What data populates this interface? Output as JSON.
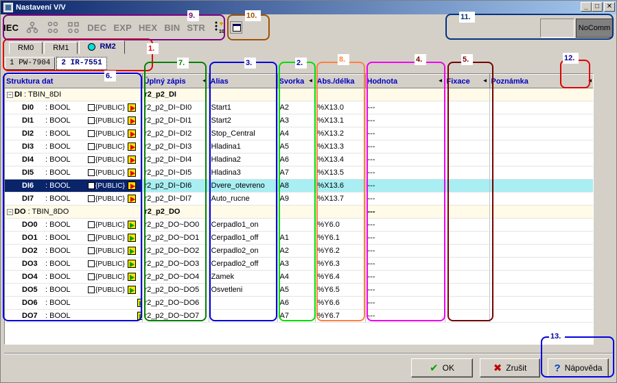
{
  "window": {
    "title": "Nastavení V/V"
  },
  "toolbar": {
    "iec": "IEC",
    "formats": [
      "DEC",
      "EXP",
      "HEX",
      "BIN",
      "STR"
    ]
  },
  "status": {
    "comm": "NoComm"
  },
  "rm_tabs": [
    "RM0",
    "RM1",
    "RM2"
  ],
  "module_tabs": [
    "1 PW-7904",
    "2 IR-7551"
  ],
  "columns": {
    "structure": "Struktura dat",
    "full": "Úplný zápis",
    "alias": "Alias",
    "terminal": "Svorka",
    "abs": "Abs./délka",
    "value": "Hodnota",
    "fix": "Fixace",
    "note": "Poznámka"
  },
  "rows": [
    {
      "kind": "group",
      "pm": "−",
      "name": "DI",
      "type": ": TBIN_8DI",
      "full": "r2_p2_DI"
    },
    {
      "kind": "item",
      "name": "DI0",
      "type": ": BOOL",
      "pub": "{PUBLIC}",
      "dir": "in",
      "full": "r2_p2_DI~DI0",
      "alias": "Start1",
      "terminal": "A2",
      "abs": "%X13.0",
      "value": "---"
    },
    {
      "kind": "item",
      "name": "DI1",
      "type": ": BOOL",
      "pub": "{PUBLIC}",
      "dir": "in",
      "full": "r2_p2_DI~DI1",
      "alias": "Start2",
      "terminal": "A3",
      "abs": "%X13.1",
      "value": "---"
    },
    {
      "kind": "item",
      "name": "DI2",
      "type": ": BOOL",
      "pub": "{PUBLIC}",
      "dir": "in",
      "full": "r2_p2_DI~DI2",
      "alias": "Stop_Central",
      "terminal": "A4",
      "abs": "%X13.2",
      "value": "---"
    },
    {
      "kind": "item",
      "name": "DI3",
      "type": ": BOOL",
      "pub": "{PUBLIC}",
      "dir": "in",
      "full": "r2_p2_DI~DI3",
      "alias": "Hladina1",
      "terminal": "A5",
      "abs": "%X13.3",
      "value": "---"
    },
    {
      "kind": "item",
      "name": "DI4",
      "type": ": BOOL",
      "pub": "{PUBLIC}",
      "dir": "in",
      "full": "r2_p2_DI~DI4",
      "alias": "Hladina2",
      "terminal": "A6",
      "abs": "%X13.4",
      "value": "---"
    },
    {
      "kind": "item",
      "name": "DI5",
      "type": ": BOOL",
      "pub": "{PUBLIC}",
      "dir": "in",
      "full": "r2_p2_DI~DI5",
      "alias": "Hladina3",
      "terminal": "A7",
      "abs": "%X13.5",
      "value": "---"
    },
    {
      "kind": "item",
      "sel": true,
      "name": "DI6",
      "type": ": BOOL",
      "pub": "{PUBLIC}",
      "dir": "in",
      "full": "r2_p2_DI~DI6",
      "alias": "Dvere_otevreno",
      "terminal": "A8",
      "abs": "%X13.6",
      "value": "---"
    },
    {
      "kind": "item",
      "name": "DI7",
      "type": ": BOOL",
      "pub": "{PUBLIC}",
      "dir": "in",
      "full": "r2_p2_DI~DI7",
      "alias": "Auto_rucne",
      "terminal": "A9",
      "abs": "%X13.7",
      "value": "---"
    },
    {
      "kind": "group",
      "pm": "−",
      "name": "DO",
      "type": ": TBIN_8DO",
      "full": "r2_p2_DO",
      "value": "---"
    },
    {
      "kind": "item",
      "name": "DO0",
      "type": ": BOOL",
      "pub": "{PUBLIC}",
      "dir": "out",
      "full": "r2_p2_DO~DO0",
      "alias": "Cerpadlo1_on",
      "terminal": "",
      "abs": "%Y6.0",
      "value": "---"
    },
    {
      "kind": "item",
      "name": "DO1",
      "type": ": BOOL",
      "pub": "{PUBLIC}",
      "dir": "out",
      "full": "r2_p2_DO~DO1",
      "alias": "Cerpadlo1_off",
      "terminal": "A1",
      "abs": "%Y6.1",
      "value": "---"
    },
    {
      "kind": "item",
      "name": "DO2",
      "type": ": BOOL",
      "pub": "{PUBLIC}",
      "dir": "out",
      "full": "r2_p2_DO~DO2",
      "alias": "Cerpadlo2_on",
      "terminal": "A2",
      "abs": "%Y6.2",
      "value": "---"
    },
    {
      "kind": "item",
      "name": "DO3",
      "type": ": BOOL",
      "pub": "{PUBLIC}",
      "dir": "out",
      "full": "r2_p2_DO~DO3",
      "alias": "Cerpadlo2_off",
      "terminal": "A3",
      "abs": "%Y6.3",
      "value": "---"
    },
    {
      "kind": "item",
      "name": "DO4",
      "type": ": BOOL",
      "pub": "{PUBLIC}",
      "dir": "out",
      "full": "r2_p2_DO~DO4",
      "alias": "Zamek",
      "terminal": "A4",
      "abs": "%Y6.4",
      "value": "---"
    },
    {
      "kind": "item",
      "name": "DO5",
      "type": ": BOOL",
      "pub": "{PUBLIC}",
      "dir": "out",
      "full": "r2_p2_DO~DO5",
      "alias": "Osvetleni",
      "terminal": "A5",
      "abs": "%Y6.5",
      "value": "---"
    },
    {
      "kind": "item",
      "name": "DO6",
      "type": ": BOOL",
      "pub": "",
      "dir": "out",
      "full": "r2_p2_DO~DO6",
      "alias": "",
      "terminal": "A6",
      "abs": "%Y6.6",
      "value": "---"
    },
    {
      "kind": "item",
      "name": "DO7",
      "type": ": BOOL",
      "pub": "",
      "dir": "out",
      "full": "r2_p2_DO~DO7",
      "alias": "",
      "terminal": "A7",
      "abs": "%Y6.7",
      "value": "---"
    }
  ],
  "buttons": {
    "ok": "OK",
    "cancel": "Zrušit",
    "help": "Nápověda"
  },
  "annotations": [
    "1.",
    "2.",
    "3.",
    "4.",
    "5.",
    "6.",
    "7.",
    "8.",
    "9.",
    "10.",
    "11.",
    "12.",
    "13."
  ],
  "colors": {
    "ann_1": "#e00000",
    "ann_2": "#00dd00",
    "ann_3": "#0000dd",
    "ann_4": "#ee00ee",
    "ann_5": "#700000",
    "ann_6": "#0000dd",
    "ann_7": "#008000",
    "ann_8": "#ff8040",
    "ann_9": "#800080",
    "ann_10": "#a05000",
    "ann_11": "#003080",
    "ann_12": "#e00000",
    "ann_13": "#0000dd"
  }
}
